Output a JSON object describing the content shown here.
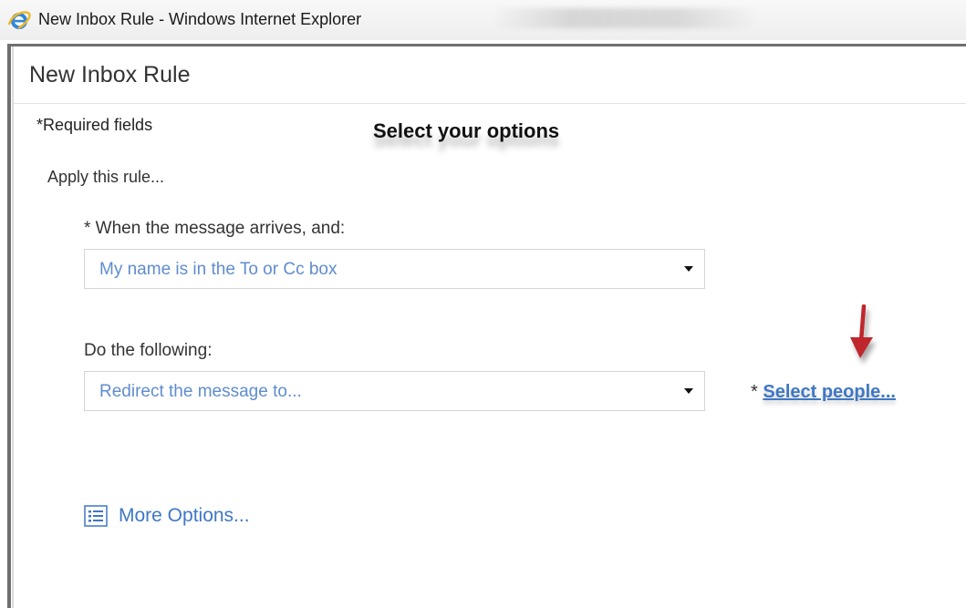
{
  "window": {
    "title": "New Inbox Rule - Windows Internet Explorer",
    "icon": "internet-explorer-icon"
  },
  "dialog": {
    "title": "New Inbox Rule",
    "required_note": "*Required fields",
    "heading": "Select your options",
    "apply_label": "Apply this rule..."
  },
  "condition": {
    "label": "* When the message arrives, and:",
    "selected": "My name is in the To or Cc box"
  },
  "action": {
    "label": "Do the following:",
    "selected": "Redirect the message to...",
    "required_marker": "*",
    "link": "Select people..."
  },
  "more_options": {
    "label": "More Options...",
    "icon": "list-icon"
  },
  "annotation": {
    "icon": "red-arrow-icon",
    "color": "#c0272d"
  },
  "colors": {
    "link": "#3f77c4",
    "select_value": "#5f8dcc",
    "frame": "#6f6f6f"
  }
}
